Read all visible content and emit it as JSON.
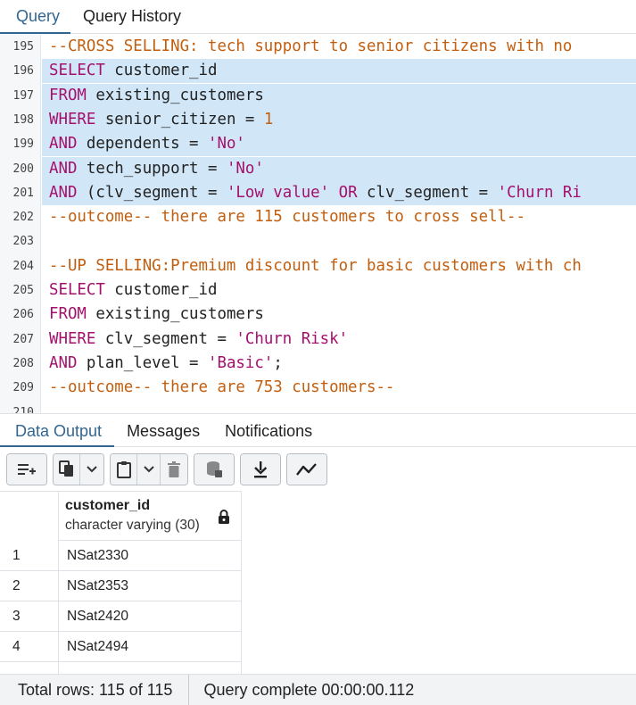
{
  "top_tabs": [
    {
      "label": "Query",
      "active": true
    },
    {
      "label": "Query History",
      "active": false
    }
  ],
  "editor": {
    "lines": [
      {
        "num": "195",
        "selected": false,
        "tokens": [
          [
            "cm",
            "--CROSS SELLING: tech support to senior citizens with no"
          ]
        ]
      },
      {
        "num": "196",
        "selected": true,
        "tokens": [
          [
            "kw",
            "SELECT"
          ],
          [
            "plain",
            " customer_id"
          ]
        ]
      },
      {
        "num": "197",
        "selected": true,
        "tokens": [
          [
            "kw",
            "FROM"
          ],
          [
            "plain",
            " existing_customers"
          ]
        ]
      },
      {
        "num": "198",
        "selected": true,
        "tokens": [
          [
            "kw",
            "WHERE"
          ],
          [
            "plain",
            " senior_citizen = "
          ],
          [
            "num-lit",
            "1"
          ]
        ]
      },
      {
        "num": "199",
        "selected": true,
        "tokens": [
          [
            "kw",
            "AND"
          ],
          [
            "plain",
            " dependents = "
          ],
          [
            "str",
            "'No'"
          ]
        ]
      },
      {
        "num": "200",
        "selected": true,
        "tokens": [
          [
            "kw",
            "AND"
          ],
          [
            "plain",
            " tech_support = "
          ],
          [
            "str",
            "'No'"
          ]
        ]
      },
      {
        "num": "201",
        "selected": true,
        "tokens": [
          [
            "kw",
            "AND"
          ],
          [
            "plain",
            " (clv_segment = "
          ],
          [
            "str",
            "'Low value'"
          ],
          [
            "plain",
            " "
          ],
          [
            "kw",
            "OR"
          ],
          [
            "plain",
            " clv_segment = "
          ],
          [
            "str",
            "'Churn Ri"
          ]
        ]
      },
      {
        "num": "202",
        "selected": false,
        "tokens": [
          [
            "cm",
            "--outcome-- there are 115 customers to cross sell--"
          ]
        ]
      },
      {
        "num": "203",
        "selected": false,
        "tokens": []
      },
      {
        "num": "204",
        "selected": false,
        "tokens": [
          [
            "cm",
            "--UP SELLING:Premium discount for basic customers with ch"
          ]
        ]
      },
      {
        "num": "205",
        "selected": false,
        "tokens": [
          [
            "kw",
            "SELECT"
          ],
          [
            "plain",
            " customer_id"
          ]
        ]
      },
      {
        "num": "206",
        "selected": false,
        "tokens": [
          [
            "kw",
            "FROM"
          ],
          [
            "plain",
            " existing_customers"
          ]
        ]
      },
      {
        "num": "207",
        "selected": false,
        "tokens": [
          [
            "kw",
            "WHERE"
          ],
          [
            "plain",
            " clv_segment = "
          ],
          [
            "str",
            "'Churn Risk'"
          ]
        ]
      },
      {
        "num": "208",
        "selected": false,
        "tokens": [
          [
            "kw",
            "AND"
          ],
          [
            "plain",
            " plan_level = "
          ],
          [
            "str",
            "'Basic'"
          ],
          [
            "plain",
            ";"
          ]
        ]
      },
      {
        "num": "209",
        "selected": false,
        "tokens": [
          [
            "cm",
            "--outcome-- there are 753 customers--"
          ]
        ]
      },
      {
        "num": "210",
        "selected": false,
        "tokens": []
      }
    ]
  },
  "output_tabs": [
    {
      "label": "Data Output",
      "active": true
    },
    {
      "label": "Messages",
      "active": false
    },
    {
      "label": "Notifications",
      "active": false
    }
  ],
  "toolbar": {
    "icons": [
      "add-row-icon",
      "copy-icon",
      "chevron-down-icon",
      "paste-icon",
      "chevron-down-icon",
      "delete-icon",
      "save-data-icon",
      "download-icon",
      "graph-icon"
    ]
  },
  "grid": {
    "column": {
      "name": "customer_id",
      "type": "character varying (30)",
      "locked": true
    },
    "rows": [
      {
        "n": "1",
        "value": "NSat2330"
      },
      {
        "n": "2",
        "value": "NSat2353"
      },
      {
        "n": "3",
        "value": "NSat2420"
      },
      {
        "n": "4",
        "value": "NSat2494"
      }
    ]
  },
  "status": {
    "total_rows": "Total rows: 115 of 115",
    "query_complete": "Query complete 00:00:00.112"
  },
  "colors": {
    "accent": "#326690",
    "keyword": "#a4106b",
    "comment": "#c25e0e",
    "selection": "#d1e7f8"
  }
}
